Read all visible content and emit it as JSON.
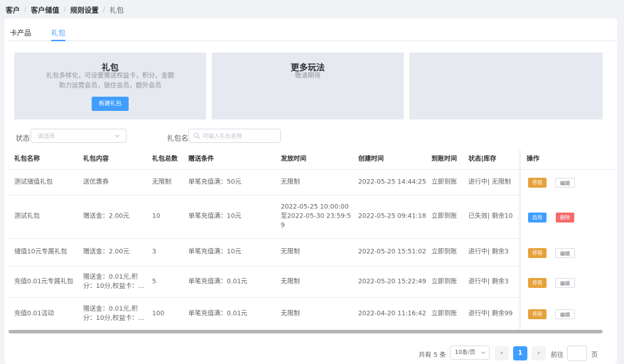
{
  "breadcrumb": [
    "客户",
    "客户储值",
    "规则设置",
    "礼包"
  ],
  "tabs": [
    "卡产品",
    "礼包"
  ],
  "promo": {
    "gift_title": "礼包",
    "gift_desc_1": "礼包多样化，可设置赠送权益卡，积分，金额",
    "gift_desc_2": "助力运营会员，锁住会员，额外会员",
    "new_button": "新建礼包",
    "more_title": "更多玩法",
    "more_desc": "敬请期待"
  },
  "filters": {
    "status_label": "状态",
    "status_placeholder": "请选择",
    "name_label": "礼包名",
    "name_placeholder": "可输入礼包名称"
  },
  "table": {
    "columns": [
      "礼包名称",
      "礼包内容",
      "礼包总数",
      "赠送条件",
      "发放时间",
      "创建时间",
      "到账时间",
      "状态|库存",
      "操作"
    ],
    "rows": [
      {
        "name": "测试储值礼包",
        "content_1": "送优惠券",
        "content_2": "",
        "total": "无限制",
        "condition": "单笔充值满：50元",
        "issue_1": "无限制",
        "issue_2": "",
        "issue_3": "",
        "created": "2022-05-25 14:44:25",
        "arrive": "立即到账",
        "status": "进行中| 无限制",
        "op1": "停用",
        "op2": "编辑"
      },
      {
        "name": "测试礼包",
        "content_1": "赠送金：2.00元",
        "content_2": "",
        "total": "10",
        "condition": "单笔充值满：10元",
        "issue_1": "2022-05-25 10:00:00",
        "issue_2": "至2022-05-30 23:59:5",
        "issue_3": "9",
        "created": "2022-05-25 09:41:18",
        "arrive": "立即到账",
        "status": "已失效| 剩余10",
        "op1": "启用",
        "op2": "删除"
      },
      {
        "name": "储值10元专属礼包",
        "content_1": "赠送金：2.00元",
        "content_2": "",
        "total": "3",
        "condition": "单笔充值满：10元",
        "issue_1": "无限制",
        "issue_2": "",
        "issue_3": "",
        "created": "2022-05-20 15:51:02",
        "arrive": "立即到账",
        "status": "进行中| 剩余3",
        "op1": "停用",
        "op2": "编辑"
      },
      {
        "name": "充值0.01元专属礼包",
        "content_1": "赠送金：0.01元,积",
        "content_2": "分：10分,权益卡：...",
        "total": "5",
        "condition": "单笔充值满：0.01元",
        "issue_1": "无限制",
        "issue_2": "",
        "issue_3": "",
        "created": "2022-05-20 15:22:49",
        "arrive": "立即到账",
        "status": "进行中| 剩余3",
        "op1": "停用",
        "op2": "编辑"
      },
      {
        "name": "充值0.01活动",
        "content_1": "赠送金：0.01元,积",
        "content_2": "分：10分,权益卡：...",
        "total": "100",
        "condition": "单笔充值满：0.01元",
        "issue_1": "无限制",
        "issue_2": "",
        "issue_3": "",
        "created": "2022-04-20 11:16:42",
        "arrive": "立即到账",
        "status": "进行中| 剩余99",
        "op1": "停用",
        "op2": "编辑"
      }
    ]
  },
  "pagination": {
    "total_text": "共有 5 条",
    "page_size": "10条/页",
    "prev": "‹",
    "current": "1",
    "next": "›",
    "goto_label": "前往",
    "page_suffix": "页"
  },
  "colors": {
    "primary": "#409eff",
    "warning": "#e6a23c",
    "danger": "#f56c6c"
  },
  "icons": [
    "chevron-down-icon",
    "search-icon"
  ]
}
